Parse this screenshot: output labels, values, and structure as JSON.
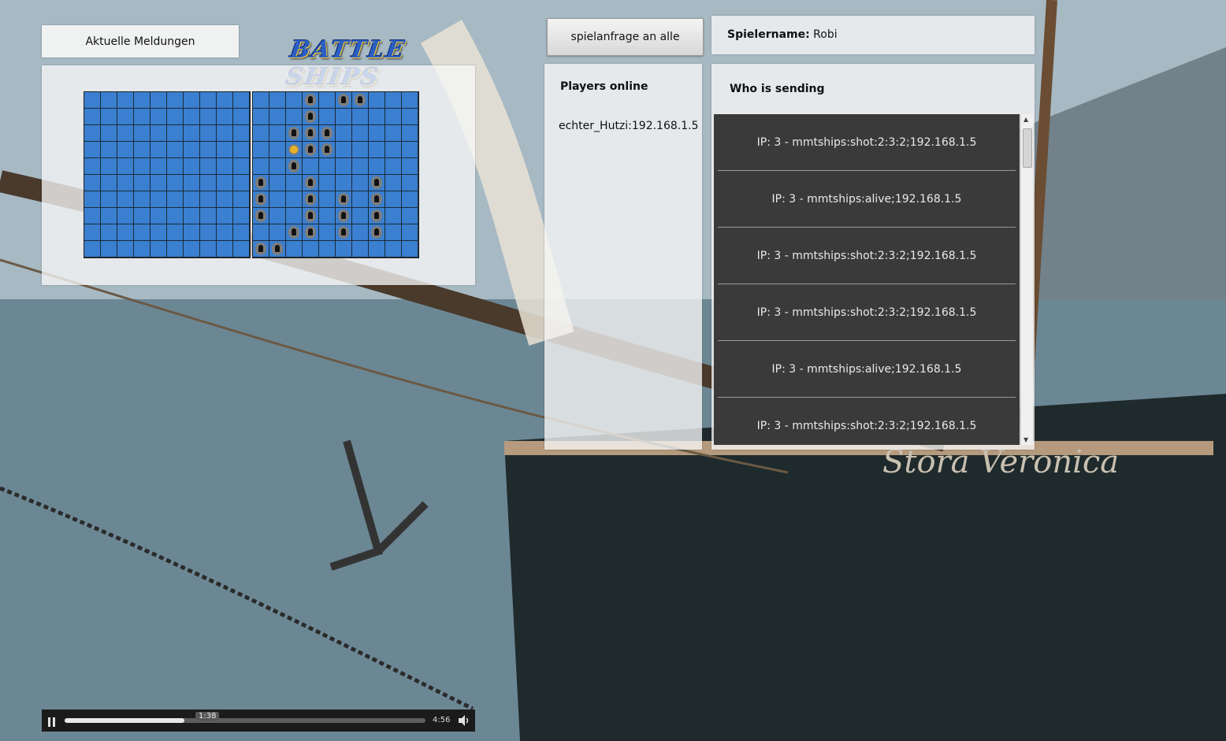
{
  "header": {
    "messages_button": "Aktuelle Meldungen",
    "logo_text": "BATTLE SHIPS",
    "broadcast_button": "spielanfrage an alle",
    "player_label": "Spielername:",
    "player_name": "Robi"
  },
  "boards": {
    "own": {
      "rows": 10,
      "cols": 10
    },
    "enemy": {
      "rows": 10,
      "cols": 10,
      "ships": [
        [
          0,
          3
        ],
        [
          1,
          3
        ],
        [
          2,
          2
        ],
        [
          2,
          3
        ],
        [
          3,
          2
        ],
        [
          3,
          3
        ],
        [
          3,
          4
        ],
        [
          4,
          2
        ],
        [
          5,
          0
        ],
        [
          5,
          3
        ],
        [
          5,
          7
        ],
        [
          6,
          0
        ],
        [
          6,
          3
        ],
        [
          6,
          5
        ],
        [
          6,
          7
        ],
        [
          7,
          0
        ],
        [
          7,
          3
        ],
        [
          7,
          5
        ],
        [
          7,
          7
        ],
        [
          8,
          2
        ],
        [
          8,
          3
        ],
        [
          8,
          5
        ],
        [
          8,
          7
        ],
        [
          9,
          0
        ],
        [
          9,
          1
        ],
        [
          0,
          5
        ],
        [
          0,
          6
        ],
        [
          2,
          4
        ]
      ],
      "hits": [
        [
          3,
          2
        ]
      ]
    }
  },
  "players_panel": {
    "title": "Players online",
    "players": [
      "echter_Hutzi:192.168.1.5"
    ]
  },
  "sending_panel": {
    "title": "Who is sending",
    "messages": [
      "IP: 3 - mmtships:shot:2:3:2;192.168.1.5",
      "IP: 3 - mmtships:alive;192.168.1.5",
      "IP: 3 - mmtships:shot:2:3:2;192.168.1.5",
      "IP: 3 - mmtships:shot:2:3:2;192.168.1.5",
      "IP: 3 - mmtships:alive;192.168.1.5",
      "IP: 3 - mmtships:shot:2:3:2;192.168.1.5"
    ]
  },
  "video": {
    "current_time": "1:38",
    "duration": "4:56",
    "progress_fraction": 0.331
  }
}
